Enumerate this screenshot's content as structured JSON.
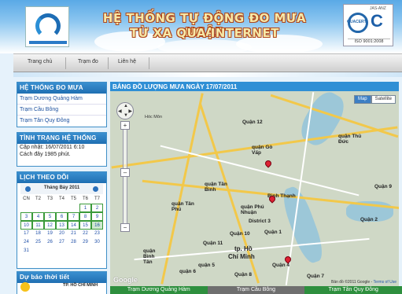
{
  "header": {
    "title_line1": "HỆ THỐNG TỰ ĐỘNG ĐO MƯA NGẬP",
    "title_line2": "TỪ XA QUA INTERNET",
    "logo_right": {
      "badge": "QUACERT",
      "top": "JAS-ANZ",
      "iso": "ISO 9001:2008"
    }
  },
  "nav": {
    "items": [
      "Trang chủ",
      "Trạm đo",
      "Liên hệ"
    ]
  },
  "sidebar": {
    "stations_title": "HỆ THỐNG ĐO MƯA",
    "stations": [
      "Trạm Dương Quảng Hàm",
      "Trạm Cầu Bông",
      "Trạm Tân Quy Đông"
    ],
    "status_title": "TÌNH TRẠNG HỆ THỐNG",
    "status_lines": [
      "Cập nhật: 16/07/2011 6:10",
      "Cách đây 1985 phút."
    ],
    "calendar_title": "LỊCH THEO DÕI",
    "calendar_month": "Tháng Bảy 2011",
    "weekdays": [
      "CN",
      "T2",
      "T3",
      "T4",
      "T5",
      "T6",
      "T7"
    ],
    "weeks": [
      [
        "",
        "",
        "",
        "",
        "",
        "1",
        "2"
      ],
      [
        "3",
        "4",
        "5",
        "6",
        "7",
        "8",
        "9"
      ],
      [
        "10",
        "11",
        "12",
        "13",
        "14",
        "15",
        "16"
      ],
      [
        "17",
        "18",
        "19",
        "20",
        "21",
        "22",
        "23"
      ],
      [
        "24",
        "25",
        "26",
        "27",
        "28",
        "29",
        "30"
      ],
      [
        "31",
        "",
        "",
        "",
        "",
        "",
        ""
      ]
    ],
    "forecast_title": "Dự báo thời tiết",
    "forecast_city": "TP. HỒ CHÍ MINH"
  },
  "main": {
    "title": "BẢNG ĐỒ LƯỢNG MƯA NGÀY 17/07/2011",
    "map_buttons": [
      "Map",
      "Satellite"
    ],
    "labels": {
      "q12": "Quận 12",
      "govap": "quận Gò Vấp",
      "tanbinh": "quận Tân Bình",
      "tanphu": "quận Tân Phú",
      "binhthanh": "Bình Thạnh",
      "phunhuan": "quận Phú Nhuận",
      "q3": "District 3",
      "q10": "Quận 10",
      "q1": "Quận 1",
      "q2": "Quận 2",
      "thuduc": "quận Thủ Đức",
      "hcm1": "tp. Hồ",
      "hcm2": "Chí Minh",
      "q11": "Quận 11",
      "q5": "quận 5",
      "q8": "Quận 8",
      "q4": "Quận 4",
      "q7": "Quận 7",
      "binhtan": "quận Bình Tân",
      "hocmon": "Hóc Môn",
      "q6": "quận 6",
      "q9": "Quận 9"
    },
    "copyright": "Bản đồ ©2011 Google -",
    "terms": "Terms of Use",
    "google": "Google"
  },
  "tabs": [
    "Trạm Dương Quảng Hàm",
    "Trạm Cầu Bông",
    "Trạm Tân Quy Đông"
  ]
}
